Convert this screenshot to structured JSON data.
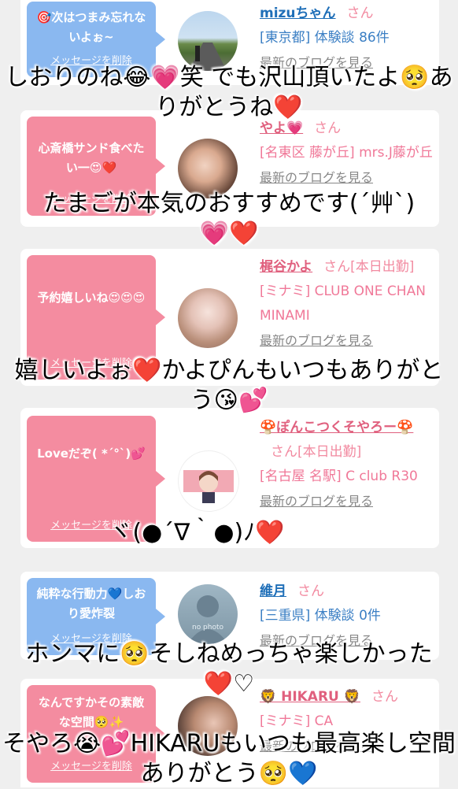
{
  "cards": [
    {
      "bubble_color": "blue",
      "message": "🎯次はつまみ忘れないよぉ~",
      "delete_label": "メッセージを削除",
      "name": "mizuちゃん",
      "honorific": "さん",
      "meta": "[東京都] 体験談 86件",
      "blog_link": "最新のブログを見る",
      "avatar": "road-landscape"
    },
    {
      "bubble_color": "pink",
      "message": "心斎橋サンド食べたい一😍❤️",
      "delete_label": "メッセージを削除",
      "name": "やよ💗",
      "honorific": "さん",
      "meta": "[名東区 藤が丘] mrs.J藤が丘",
      "blog_link": "最新のブログを見る",
      "avatar": "woman-photo"
    },
    {
      "bubble_color": "pink",
      "message": "予約嬉しいね😍😍😍",
      "delete_label": "メッセージを削除",
      "name": "梶谷かよ",
      "honorific": "さん[本日出勤]",
      "meta": "[ミナミ] CLUB ONE CHAN MINAMI",
      "blog_link": "最新のブログを見る",
      "avatar": "woman-photo"
    },
    {
      "bubble_color": "pink",
      "message": "Loveだぞ( *´°`)💕",
      "delete_label": "メッセージを削除",
      "name": "🍄ぽんこつくそやろー🍄",
      "honorific": "さん[本日出勤]",
      "meta": "[名古屋 名駅] C club R30",
      "blog_link": "最新のブログを見る",
      "avatar": "illustration"
    },
    {
      "bubble_color": "blue",
      "message": "純粋な行動力💙しおり愛炸裂",
      "delete_label": "メッセージを削除",
      "name": "維月",
      "honorific": "さん",
      "meta": "[三重県] 体験談 0件",
      "blog_link": "最新のブログを見る",
      "avatar_text": "no photo"
    },
    {
      "bubble_color": "pink",
      "message": "なんですかその素敵な空間🥺✨",
      "delete_label": "メッセージを削除",
      "name": "🦁 HIKARU 🦁",
      "honorific": "さん",
      "meta": "[ミナミ] CA",
      "blog_link": "最新のブログを見る",
      "avatar": "woman-photo"
    }
  ],
  "overlays": [
    "しおりのね😂💗笑 でも沢山頂いたよ🥺ありがとうね❤️",
    "たまごが本気のおすすめです(´艸`)💗❤️",
    "嬉しいよぉ❤️かよぴんもいつもありがとう😘💕",
    "ヾ(●´∇｀●)ﾉ❤️",
    "ホンマに🥺そしねめっちゃ楽しかった❤️♡",
    "そやろ😭💕HIKARUもいつも最高楽し空間ありがとう🥺💙"
  ],
  "colors": {
    "pink_bubble": "#f48ca0",
    "blue_bubble": "#8ab8f0",
    "link_blue": "#1f6fb8",
    "link_pink": "#e0607e"
  }
}
